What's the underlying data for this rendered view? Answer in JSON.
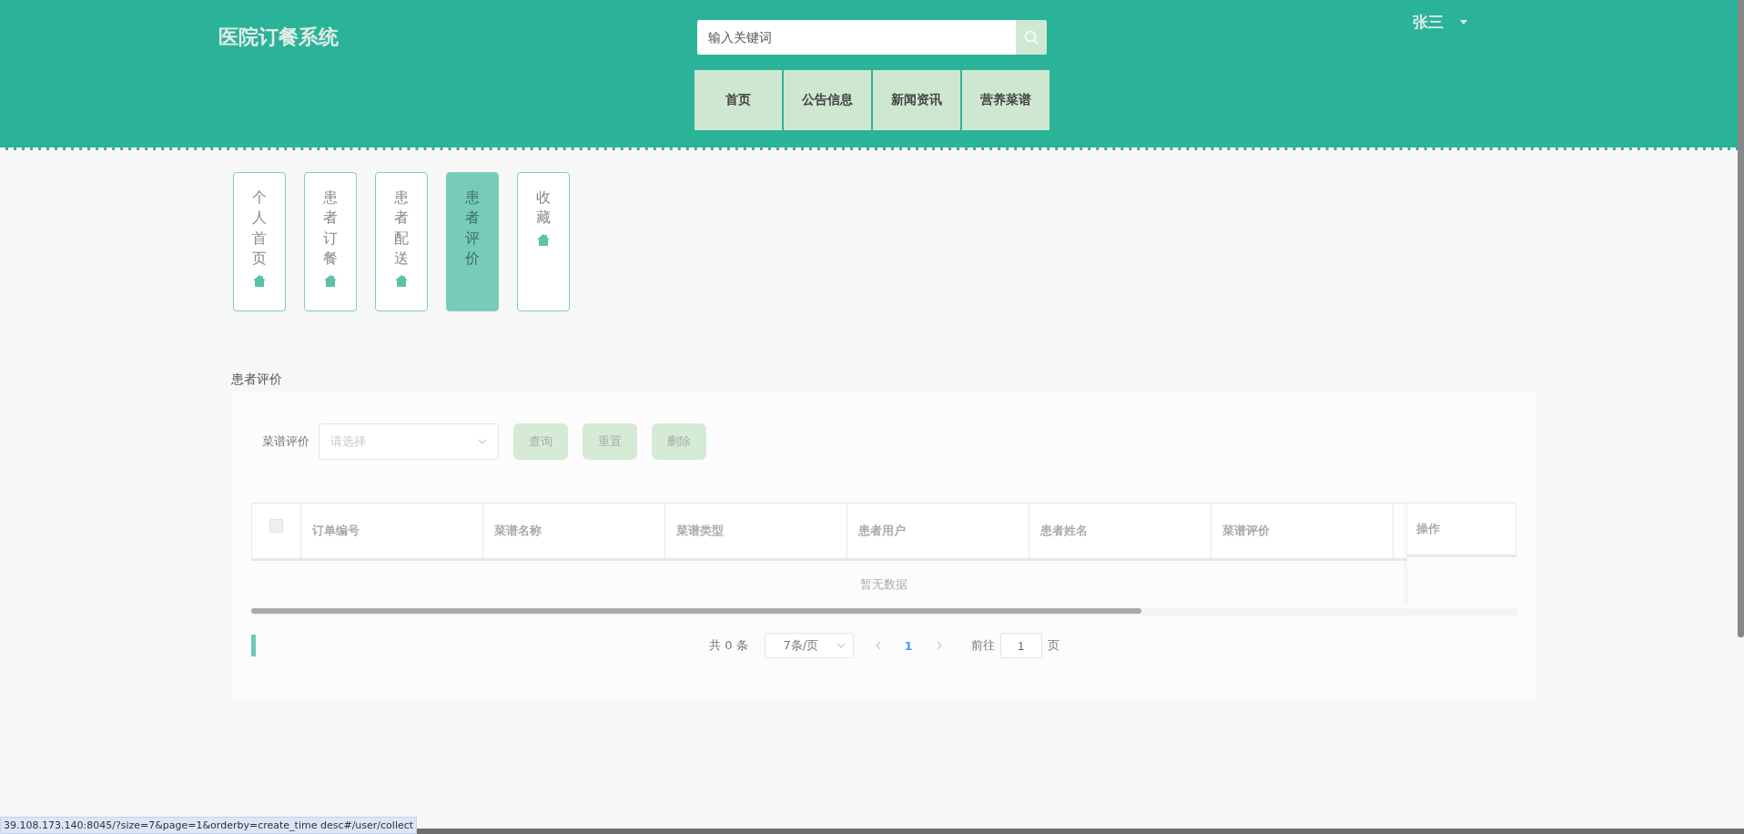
{
  "header": {
    "title": "医院订餐系统",
    "search": {
      "placeholder": "输入关键词"
    },
    "user": "张三",
    "nav": [
      {
        "label": "首页",
        "selected": false
      },
      {
        "label": "公告信息",
        "selected": false
      },
      {
        "label": "新闻资讯",
        "selected": false
      },
      {
        "label": "营养菜谱",
        "selected": false
      }
    ]
  },
  "side_tabs": [
    {
      "label": "个人首页",
      "selected": false,
      "icon": true
    },
    {
      "label": "患者订餐",
      "selected": false,
      "icon": true
    },
    {
      "label": "患者配送",
      "selected": false,
      "icon": true
    },
    {
      "label": "患者评价",
      "selected": true,
      "icon": false
    },
    {
      "label": "收藏",
      "selected": false,
      "icon": true
    }
  ],
  "section_title": "患者评价",
  "filter": {
    "label": "菜谱评价",
    "select": {
      "placeholder": "请选择"
    },
    "buttons": [
      "查询",
      "重置",
      "删除"
    ]
  },
  "table": {
    "header_checkbox": {
      "checked": false
    },
    "columns": [
      "订单编号",
      "菜谱名称",
      "菜谱类型",
      "患者用户",
      "患者姓名",
      "菜谱评价"
    ],
    "fixed_column": "操作",
    "empty_text": "暂无数据"
  },
  "pagination": {
    "total": "共 0 条",
    "page_size": "7条/页",
    "pages": [
      {
        "label": "1",
        "selected": true
      }
    ],
    "goto_label": "前往",
    "goto_value": "1",
    "goto_suffix": "页"
  },
  "status_bar": "39.108.173.140:8045/?size=7&page=1&orderby=create_time desc#/user/collect"
}
